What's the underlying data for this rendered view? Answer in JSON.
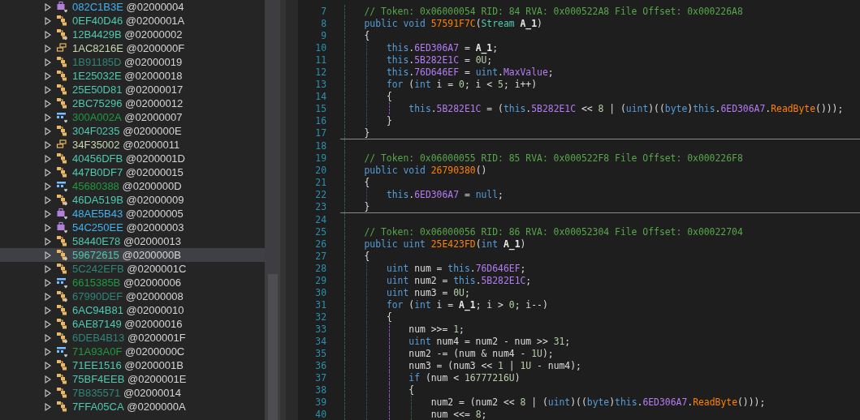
{
  "tree": {
    "items": [
      {
        "name": "082C1B3E",
        "token": "@02000004",
        "kind": "interface",
        "overlay": true,
        "dimmed": false,
        "selected": false
      },
      {
        "name": "0EF40D46",
        "token": "@0200001A",
        "kind": "class",
        "overlay": false,
        "dimmed": false,
        "selected": false
      },
      {
        "name": "12B4429B",
        "token": "@02000002",
        "kind": "class",
        "overlay": true,
        "dimmed": false,
        "selected": false
      },
      {
        "name": "1AC8216E",
        "token": "@0200000F",
        "kind": "struct",
        "overlay": false,
        "dimmed": false,
        "selected": false
      },
      {
        "name": "1B91185D",
        "token": "@02000019",
        "kind": "class",
        "overlay": false,
        "dimmed": true,
        "selected": false
      },
      {
        "name": "1E25032E",
        "token": "@02000018",
        "kind": "class",
        "overlay": false,
        "dimmed": false,
        "selected": false
      },
      {
        "name": "25E50D81",
        "token": "@02000017",
        "kind": "class",
        "overlay": false,
        "dimmed": false,
        "selected": false
      },
      {
        "name": "2BC75296",
        "token": "@02000012",
        "kind": "class",
        "overlay": false,
        "dimmed": false,
        "selected": false
      },
      {
        "name": "300A002A",
        "token": "@02000007",
        "kind": "enum",
        "overlay": true,
        "dimmed": false,
        "selected": false
      },
      {
        "name": "304F0235",
        "token": "@0200000E",
        "kind": "class",
        "overlay": false,
        "dimmed": false,
        "selected": false
      },
      {
        "name": "34F35002",
        "token": "@02000011",
        "kind": "struct",
        "overlay": false,
        "dimmed": false,
        "selected": false
      },
      {
        "name": "40456DFB",
        "token": "@0200001D",
        "kind": "class",
        "overlay": false,
        "dimmed": false,
        "selected": false
      },
      {
        "name": "447B0DF7",
        "token": "@02000015",
        "kind": "class",
        "overlay": false,
        "dimmed": false,
        "selected": false
      },
      {
        "name": "45680388",
        "token": "@0200000D",
        "kind": "enum",
        "overlay": true,
        "dimmed": false,
        "selected": false
      },
      {
        "name": "46DA519B",
        "token": "@02000009",
        "kind": "class",
        "overlay": true,
        "dimmed": false,
        "selected": false
      },
      {
        "name": "48AE5B43",
        "token": "@02000005",
        "kind": "interface",
        "overlay": true,
        "dimmed": false,
        "selected": false
      },
      {
        "name": "54C250EE",
        "token": "@02000003",
        "kind": "interface",
        "overlay": true,
        "dimmed": false,
        "selected": false
      },
      {
        "name": "58440E78",
        "token": "@02000013",
        "kind": "class",
        "overlay": false,
        "dimmed": false,
        "selected": false
      },
      {
        "name": "59672615",
        "token": "@0200000B",
        "kind": "class",
        "overlay": true,
        "dimmed": false,
        "selected": true
      },
      {
        "name": "5C242EFB",
        "token": "@0200001C",
        "kind": "class",
        "overlay": false,
        "dimmed": true,
        "selected": false
      },
      {
        "name": "6615385B",
        "token": "@02000006",
        "kind": "enum",
        "overlay": true,
        "dimmed": false,
        "selected": false
      },
      {
        "name": "67990DEF",
        "token": "@02000008",
        "kind": "class",
        "overlay": true,
        "dimmed": true,
        "selected": false
      },
      {
        "name": "6AC94B81",
        "token": "@02000010",
        "kind": "class",
        "overlay": false,
        "dimmed": false,
        "selected": false
      },
      {
        "name": "6AE87149",
        "token": "@02000016",
        "kind": "class",
        "overlay": false,
        "dimmed": false,
        "selected": false
      },
      {
        "name": "6DEB4B13",
        "token": "@0200001F",
        "kind": "class",
        "overlay": true,
        "dimmed": true,
        "selected": false
      },
      {
        "name": "71A93A0F",
        "token": "@0200000C",
        "kind": "enum",
        "overlay": true,
        "dimmed": false,
        "selected": false
      },
      {
        "name": "71EE1516",
        "token": "@0200001B",
        "kind": "class",
        "overlay": false,
        "dimmed": false,
        "selected": false
      },
      {
        "name": "75BF4EEB",
        "token": "@0200001E",
        "kind": "class",
        "overlay": false,
        "dimmed": false,
        "selected": false
      },
      {
        "name": "7B835571",
        "token": "@02000014",
        "kind": "class",
        "overlay": false,
        "dimmed": true,
        "selected": false
      },
      {
        "name": "7FFA05CA",
        "token": "@0200000A",
        "kind": "class",
        "overlay": false,
        "dimmed": false,
        "selected": false
      }
    ]
  },
  "code": {
    "blocks": [
      {
        "lines": [
          {
            "number": "7",
            "tokens": [
              {
                "kind": "comment",
                "text": "    // Token: 0x06000054 RID: 84 RVA: 0x000522A8 File Offset: 0x000226A8"
              }
            ]
          },
          {
            "number": "8",
            "tokens": [
              {
                "kind": "keyword",
                "text": "    public"
              },
              {
                "kind": "keyword",
                "text": " void"
              },
              {
                "kind": "method",
                "text": " 57591F7C"
              },
              {
                "kind": "plain",
                "text": "("
              },
              {
                "kind": "type",
                "text": "Stream"
              },
              {
                "kind": "param",
                "text": " A_1"
              },
              {
                "kind": "plain",
                "text": ")"
              }
            ]
          },
          {
            "number": "9",
            "tokens": [
              {
                "kind": "plain",
                "text": "    {"
              }
            ]
          },
          {
            "number": "10",
            "tokens": [
              {
                "kind": "keyword",
                "text": "        this"
              },
              {
                "kind": "plain",
                "text": "."
              },
              {
                "kind": "field",
                "text": "6ED306A7"
              },
              {
                "kind": "plain",
                "text": " = "
              },
              {
                "kind": "param",
                "text": "A_1"
              },
              {
                "kind": "plain",
                "text": ";"
              }
            ]
          },
          {
            "number": "11",
            "tokens": [
              {
                "kind": "keyword",
                "text": "        this"
              },
              {
                "kind": "plain",
                "text": "."
              },
              {
                "kind": "field",
                "text": "5B282E1C"
              },
              {
                "kind": "plain",
                "text": " = "
              },
              {
                "kind": "number",
                "text": "0U"
              },
              {
                "kind": "plain",
                "text": ";"
              }
            ]
          },
          {
            "number": "12",
            "tokens": [
              {
                "kind": "keyword",
                "text": "        this"
              },
              {
                "kind": "plain",
                "text": "."
              },
              {
                "kind": "field",
                "text": "76D646EF"
              },
              {
                "kind": "plain",
                "text": " = "
              },
              {
                "kind": "keyword",
                "text": "uint"
              },
              {
                "kind": "plain",
                "text": "."
              },
              {
                "kind": "field",
                "text": "MaxValue"
              },
              {
                "kind": "plain",
                "text": ";"
              }
            ]
          },
          {
            "number": "13",
            "tokens": [
              {
                "kind": "keyword",
                "text": "        for"
              },
              {
                "kind": "plain",
                "text": " ("
              },
              {
                "kind": "keyword",
                "text": "int"
              },
              {
                "kind": "plain",
                "text": " i = "
              },
              {
                "kind": "number",
                "text": "0"
              },
              {
                "kind": "plain",
                "text": "; i < "
              },
              {
                "kind": "number",
                "text": "5"
              },
              {
                "kind": "plain",
                "text": "; i++)"
              }
            ]
          },
          {
            "number": "14",
            "tokens": [
              {
                "kind": "plain",
                "text": "        {"
              }
            ]
          },
          {
            "number": "15",
            "tokens": [
              {
                "kind": "keyword",
                "text": "            this"
              },
              {
                "kind": "plain",
                "text": "."
              },
              {
                "kind": "field",
                "text": "5B282E1C"
              },
              {
                "kind": "plain",
                "text": " = ("
              },
              {
                "kind": "keyword",
                "text": "this"
              },
              {
                "kind": "plain",
                "text": "."
              },
              {
                "kind": "field",
                "text": "5B282E1C"
              },
              {
                "kind": "plain",
                "text": " << "
              },
              {
                "kind": "number",
                "text": "8"
              },
              {
                "kind": "plain",
                "text": " | ("
              },
              {
                "kind": "keyword",
                "text": "uint"
              },
              {
                "kind": "plain",
                "text": ")(("
              },
              {
                "kind": "keyword",
                "text": "byte"
              },
              {
                "kind": "plain",
                "text": ")"
              },
              {
                "kind": "keyword",
                "text": "this"
              },
              {
                "kind": "plain",
                "text": "."
              },
              {
                "kind": "field",
                "text": "6ED306A7"
              },
              {
                "kind": "plain",
                "text": "."
              },
              {
                "kind": "method",
                "text": "ReadByte"
              },
              {
                "kind": "plain",
                "text": "()));"
              }
            ]
          },
          {
            "number": "16",
            "tokens": [
              {
                "kind": "plain",
                "text": "        }"
              }
            ]
          },
          {
            "number": "17",
            "tokens": [
              {
                "kind": "plain",
                "text": "    }"
              }
            ]
          }
        ]
      },
      {
        "lines": [
          {
            "number": "18"
          },
          {
            "number": "19",
            "tokens": [
              {
                "kind": "comment",
                "text": "    // Token: 0x06000055 RID: 85 RVA: 0x000522F8 File Offset: 0x000226F8"
              }
            ]
          },
          {
            "number": "20",
            "tokens": [
              {
                "kind": "keyword",
                "text": "    public"
              },
              {
                "kind": "keyword",
                "text": " void"
              },
              {
                "kind": "method",
                "text": " 26790380"
              },
              {
                "kind": "plain",
                "text": "()"
              }
            ]
          },
          {
            "number": "21",
            "tokens": [
              {
                "kind": "plain",
                "text": "    {"
              }
            ]
          },
          {
            "number": "22",
            "tokens": [
              {
                "kind": "keyword",
                "text": "        this"
              },
              {
                "kind": "plain",
                "text": "."
              },
              {
                "kind": "field",
                "text": "6ED306A7"
              },
              {
                "kind": "plain",
                "text": " = "
              },
              {
                "kind": "keyword",
                "text": "null"
              },
              {
                "kind": "plain",
                "text": ";"
              }
            ]
          },
          {
            "number": "23",
            "tokens": [
              {
                "kind": "plain",
                "text": "    }"
              }
            ]
          }
        ]
      },
      {
        "lines": [
          {
            "number": "24"
          },
          {
            "number": "25",
            "tokens": [
              {
                "kind": "comment",
                "text": "    // Token: 0x06000056 RID: 86 RVA: 0x00052304 File Offset: 0x00022704"
              }
            ]
          },
          {
            "number": "26",
            "tokens": [
              {
                "kind": "keyword",
                "text": "    public"
              },
              {
                "kind": "keyword",
                "text": " uint"
              },
              {
                "kind": "method",
                "text": " 25E423FD"
              },
              {
                "kind": "plain",
                "text": "("
              },
              {
                "kind": "keyword",
                "text": "int"
              },
              {
                "kind": "param",
                "text": " A_1"
              },
              {
                "kind": "plain",
                "text": ")"
              }
            ]
          },
          {
            "number": "27",
            "tokens": [
              {
                "kind": "plain",
                "text": "    {"
              }
            ]
          },
          {
            "number": "28",
            "tokens": [
              {
                "kind": "keyword",
                "text": "        uint"
              },
              {
                "kind": "plain",
                "text": " num = "
              },
              {
                "kind": "keyword",
                "text": "this"
              },
              {
                "kind": "plain",
                "text": "."
              },
              {
                "kind": "field",
                "text": "76D646EF"
              },
              {
                "kind": "plain",
                "text": ";"
              }
            ]
          },
          {
            "number": "29",
            "tokens": [
              {
                "kind": "keyword",
                "text": "        uint"
              },
              {
                "kind": "plain",
                "text": " num2 = "
              },
              {
                "kind": "keyword",
                "text": "this"
              },
              {
                "kind": "plain",
                "text": "."
              },
              {
                "kind": "field",
                "text": "5B282E1C"
              },
              {
                "kind": "plain",
                "text": ";"
              }
            ]
          },
          {
            "number": "30",
            "tokens": [
              {
                "kind": "keyword",
                "text": "        uint"
              },
              {
                "kind": "plain",
                "text": " num3 = "
              },
              {
                "kind": "number",
                "text": "0U"
              },
              {
                "kind": "plain",
                "text": ";"
              }
            ]
          },
          {
            "number": "31",
            "tokens": [
              {
                "kind": "keyword",
                "text": "        for"
              },
              {
                "kind": "plain",
                "text": " ("
              },
              {
                "kind": "keyword",
                "text": "int"
              },
              {
                "kind": "plain",
                "text": " i = "
              },
              {
                "kind": "param",
                "text": "A_1"
              },
              {
                "kind": "plain",
                "text": "; i > "
              },
              {
                "kind": "number",
                "text": "0"
              },
              {
                "kind": "plain",
                "text": "; i--)"
              }
            ]
          },
          {
            "number": "32",
            "tokens": [
              {
                "kind": "plain",
                "text": "        {"
              }
            ]
          },
          {
            "number": "33",
            "tokens": [
              {
                "kind": "plain",
                "text": "            num >>= "
              },
              {
                "kind": "number",
                "text": "1"
              },
              {
                "kind": "plain",
                "text": ";"
              }
            ]
          },
          {
            "number": "34",
            "tokens": [
              {
                "kind": "keyword",
                "text": "            uint"
              },
              {
                "kind": "plain",
                "text": " num4 = num2 - num >> "
              },
              {
                "kind": "number",
                "text": "31"
              },
              {
                "kind": "plain",
                "text": ";"
              }
            ]
          },
          {
            "number": "35",
            "tokens": [
              {
                "kind": "plain",
                "text": "            num2 -= (num & num4 - "
              },
              {
                "kind": "number",
                "text": "1U"
              },
              {
                "kind": "plain",
                "text": ");"
              }
            ]
          },
          {
            "number": "36",
            "tokens": [
              {
                "kind": "plain",
                "text": "            num3 = (num3 << "
              },
              {
                "kind": "number",
                "text": "1"
              },
              {
                "kind": "plain",
                "text": " | "
              },
              {
                "kind": "number",
                "text": "1U"
              },
              {
                "kind": "plain",
                "text": " - num4);"
              }
            ]
          },
          {
            "number": "37",
            "tokens": [
              {
                "kind": "keyword",
                "text": "            if"
              },
              {
                "kind": "plain",
                "text": " (num < "
              },
              {
                "kind": "number",
                "text": "16777216U"
              },
              {
                "kind": "plain",
                "text": ")"
              }
            ]
          },
          {
            "number": "38",
            "tokens": [
              {
                "kind": "plain",
                "text": "            {"
              }
            ]
          },
          {
            "number": "39",
            "tokens": [
              {
                "kind": "plain",
                "text": "                num2 = (num2 << "
              },
              {
                "kind": "number",
                "text": "8"
              },
              {
                "kind": "plain",
                "text": " | ("
              },
              {
                "kind": "keyword",
                "text": "uint"
              },
              {
                "kind": "plain",
                "text": ")(("
              },
              {
                "kind": "keyword",
                "text": "byte"
              },
              {
                "kind": "plain",
                "text": ")"
              },
              {
                "kind": "keyword",
                "text": "this"
              },
              {
                "kind": "plain",
                "text": "."
              },
              {
                "kind": "field",
                "text": "6ED306A7"
              },
              {
                "kind": "plain",
                "text": "."
              },
              {
                "kind": "method",
                "text": "ReadByte"
              },
              {
                "kind": "plain",
                "text": "()));"
              }
            ]
          },
          {
            "number": "40",
            "tokens": [
              {
                "kind": "plain",
                "text": "                num <<= "
              },
              {
                "kind": "number",
                "text": "8"
              },
              {
                "kind": "plain",
                "text": ";"
              }
            ]
          }
        ]
      }
    ]
  }
}
